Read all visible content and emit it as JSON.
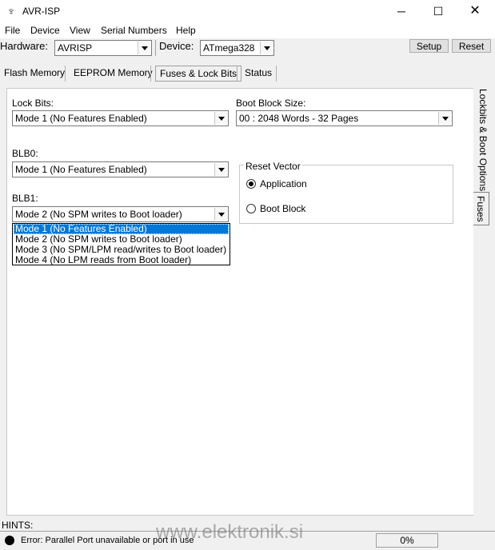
{
  "window": {
    "title": "AVR-ISP"
  },
  "menu": [
    "File",
    "Device",
    "View",
    "Serial Numbers",
    "Help"
  ],
  "toolbar": {
    "hardware_label": "Hardware:",
    "hardware_value": "AVRISP",
    "device_label": "Device:",
    "device_value": "ATmega328",
    "setup_label": "Setup",
    "reset_label": "Reset"
  },
  "tabs": [
    "Flash Memory",
    "EEPROM Memory",
    "Fuses & Lock Bits",
    "Status"
  ],
  "active_tab": "Fuses & Lock Bits",
  "fuses": {
    "lock_bits_label": "Lock Bits:",
    "lock_bits_value": "Mode 1 (No Features Enabled)",
    "boot_block_label": "Boot Block Size:",
    "boot_block_value": "00 : 2048 Words - 32 Pages",
    "blb0_label": "BLB0:",
    "blb0_value": "Mode 1 (No Features Enabled)",
    "blb1_label": "BLB1:",
    "blb1_value": "Mode 2 (No SPM writes to Boot loader)",
    "blb1_options": [
      "Mode 1 (No Features Enabled)",
      "Mode 2 (No SPM writes to Boot loader)",
      "Mode 3 (No SPM/LPM read/writes to Boot loader)",
      "Mode 4 (No LPM reads from Boot loader)"
    ],
    "blb1_selected_index": 0,
    "reset_vector": {
      "title": "Reset Vector",
      "options": [
        "Application",
        "Boot Block"
      ],
      "selected": "Application"
    }
  },
  "side_tabs": [
    "Lockbits & Boot Options",
    "Fuses"
  ],
  "hints_label": "HINTS:",
  "status": {
    "message": "Error: Parallel Port unavailable or port in use",
    "progress": "0%",
    "progress_fraction": 0
  },
  "watermark": "www.elektronik.si",
  "colors": {
    "selection": "#0078d7",
    "progress": "#06b025"
  }
}
